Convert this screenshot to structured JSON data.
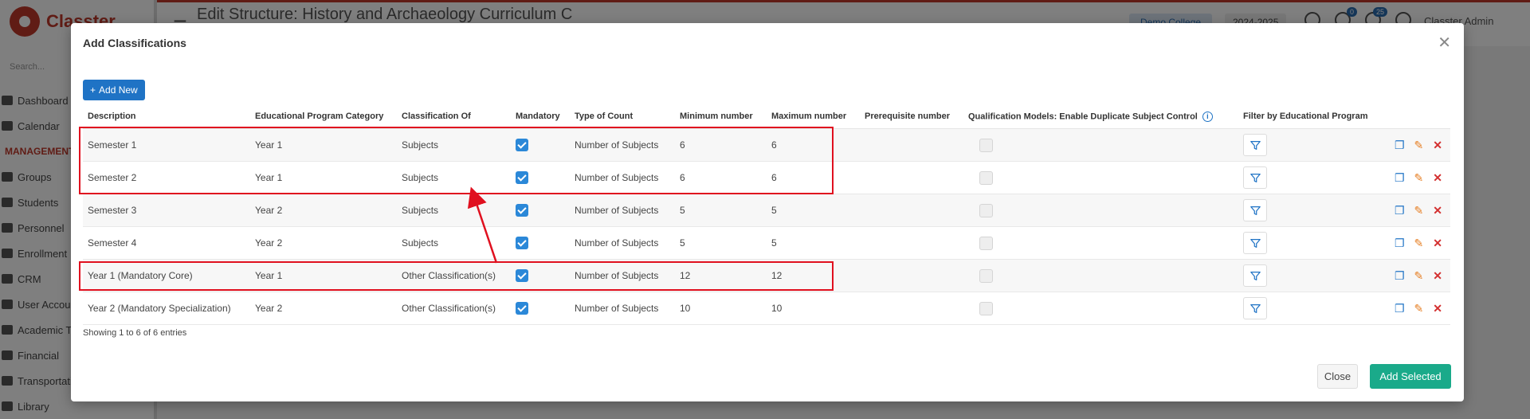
{
  "app": {
    "logo_text": "Classter",
    "search_placeholder": "Search...",
    "page_title": "Edit Structure: History and Archaeology Curriculum C",
    "college": "Demo College",
    "academic_year": "2024-2025",
    "notifications_count": "0",
    "messages_count": "25",
    "user": "Classter Admin",
    "sidebar": {
      "items_top": [
        {
          "label": "Dashboard",
          "icon": "monitor-icon"
        },
        {
          "label": "Calendar",
          "icon": "calendar-icon"
        }
      ],
      "section": "MANAGEMENT",
      "items": [
        {
          "label": "Groups",
          "icon": "groups-icon"
        },
        {
          "label": "Students",
          "icon": "students-icon"
        },
        {
          "label": "Personnel",
          "icon": "personnel-icon"
        },
        {
          "label": "Enrollment",
          "icon": "enrollment-icon"
        },
        {
          "label": "CRM",
          "icon": "crm-icon"
        },
        {
          "label": "User Accounts",
          "icon": "user-accounts-icon"
        },
        {
          "label": "Academic T",
          "icon": "academic-icon"
        },
        {
          "label": "Financial",
          "icon": "financial-icon"
        },
        {
          "label": "Transportation",
          "icon": "bus-icon"
        },
        {
          "label": "Library",
          "icon": "library-icon"
        }
      ]
    }
  },
  "modal": {
    "title": "Add Classifications",
    "add_new_label": "Add New",
    "columns": {
      "description": "Description",
      "program_category": "Educational Program Category",
      "classification_of": "Classification Of",
      "mandatory": "Mandatory",
      "type_of_count": "Type of Count",
      "minimum": "Minimum number",
      "maximum": "Maximum number",
      "prerequisite": "Prerequisite number",
      "qualification": "Qualification Models: Enable Duplicate Subject Control",
      "filter": "Filter by Educational Program"
    },
    "rows": [
      {
        "description": "Semester 1",
        "category": "Year 1",
        "classification_of": "Subjects",
        "mandatory": true,
        "type_of_count": "Number of Subjects",
        "minimum": "6",
        "maximum": "6",
        "prerequisite": ""
      },
      {
        "description": "Semester 2",
        "category": "Year 1",
        "classification_of": "Subjects",
        "mandatory": true,
        "type_of_count": "Number of Subjects",
        "minimum": "6",
        "maximum": "6",
        "prerequisite": ""
      },
      {
        "description": "Semester 3",
        "category": "Year 2",
        "classification_of": "Subjects",
        "mandatory": true,
        "type_of_count": "Number of Subjects",
        "minimum": "5",
        "maximum": "5",
        "prerequisite": ""
      },
      {
        "description": "Semester 4",
        "category": "Year 2",
        "classification_of": "Subjects",
        "mandatory": true,
        "type_of_count": "Number of Subjects",
        "minimum": "5",
        "maximum": "5",
        "prerequisite": ""
      },
      {
        "description": "Year 1 (Mandatory Core)",
        "category": "Year 1",
        "classification_of": "Other Classification(s)",
        "mandatory": true,
        "type_of_count": "Number of Subjects",
        "minimum": "12",
        "maximum": "12",
        "prerequisite": ""
      },
      {
        "description": "Year 2 (Mandatory Specialization)",
        "category": "Year 2",
        "classification_of": "Other Classification(s)",
        "mandatory": true,
        "type_of_count": "Number of Subjects",
        "minimum": "10",
        "maximum": "10",
        "prerequisite": ""
      }
    ],
    "entries_info": "Showing 1 to 6 of 6 entries",
    "close_label": "Close",
    "add_selected_label": "Add Selected"
  },
  "colors": {
    "primary": "#1f73c5",
    "success": "#1aaa8a",
    "annotation": "#e0101f",
    "brand": "#c0392b"
  }
}
